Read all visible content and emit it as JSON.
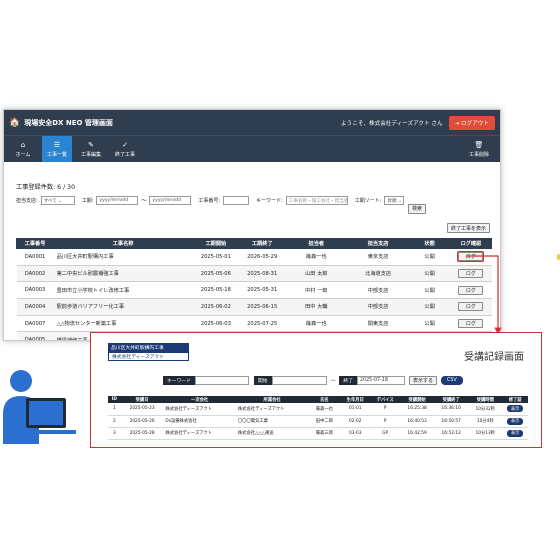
{
  "app": {
    "logo": "🏠",
    "title": "現場安全DX NEO 管理画面",
    "welcome": "ようこそ、株式会社ディーズアクト さん",
    "logout_label": "ログアウト",
    "logout_icon": "⇥"
  },
  "nav": [
    {
      "icon": "⌂",
      "label": "ホーム"
    },
    {
      "icon": "☰",
      "label": "工事一覧"
    },
    {
      "icon": "✎",
      "label": "工事編集"
    },
    {
      "icon": "✓",
      "label": "終了工事"
    },
    {
      "icon": "🗑",
      "label": "工事削除"
    }
  ],
  "projects": {
    "count_text": "工事登録件数: 6 / 30",
    "filters": {
      "branch_label": "担当支店:",
      "branch_value": "すべて ⌄",
      "period_label": "工期:",
      "date_from": "yyyy/mm/dd",
      "tilde": "〜",
      "date_to": "yyyy/mm/dd",
      "number_label": "工事番号:",
      "number_value": "",
      "keyword_label": "キーワード:",
      "keyword_placeholder": "工事名称・施工会社・担当者",
      "sort_label": "工期ソート:",
      "sort_value": "昇順 ⌄",
      "search_label": "検索"
    },
    "show_finished_label": "終了工事を表示",
    "columns": [
      "工事番号",
      "工事名称",
      "工期開始",
      "工期終了",
      "担当者",
      "担当支店",
      "状態",
      "ログ確認"
    ],
    "rows": [
      {
        "id": "DA0001",
        "name": "品川区大井町駅構内工事",
        "start": "2025-05-01",
        "end": "2026-05-29",
        "person": "篠森一也",
        "branch": "東京支店",
        "status": "公開",
        "log": "ログ"
      },
      {
        "id": "DA0002",
        "name": "第二中央ビル耐震補強工事",
        "start": "2025-05-06",
        "end": "2025-08-31",
        "person": "山田 太郎",
        "branch": "北海道支店",
        "status": "公開",
        "log": "ログ"
      },
      {
        "id": "DA0003",
        "name": "豊田市立小学校トイレ改修工事",
        "start": "2025-05-18",
        "end": "2025-05-31",
        "person": "中村 一郎",
        "branch": "中部支店",
        "status": "公開",
        "log": "ログ"
      },
      {
        "id": "DA0004",
        "name": "駅前歩道バリアフリー化工事",
        "start": "2025-06-02",
        "end": "2025-06-15",
        "person": "田中 大輔",
        "branch": "中部支店",
        "status": "公開",
        "log": "ログ"
      },
      {
        "id": "DA0007",
        "name": "△△物流センター新築工事",
        "start": "2025-06-03",
        "end": "2025-07-25",
        "person": "篠森一也",
        "branch": "関東支店",
        "status": "公開",
        "log": "ログ"
      },
      {
        "id": "DA0005",
        "name": "橋梁補修工事",
        "start": "",
        "end": "",
        "person": "",
        "branch": "",
        "status": "",
        "log": ""
      }
    ]
  },
  "panel": {
    "site_name": "品川区大井町駅構内工事",
    "company": "株式会社ディーズアクト",
    "title": "受講記録画面",
    "keyword_label": "キーワード",
    "keyword_value": "",
    "start_label": "開始",
    "start_value": "",
    "tilde": "〜",
    "end_label": "終了",
    "end_value": "2025-07-18",
    "show_label": "表示する",
    "csv_label": "CSV",
    "columns": [
      "ID",
      "受講日",
      "一次会社",
      "所属会社",
      "氏名",
      "生年月日",
      "デバイス",
      "受講開始",
      "受講終了",
      "受講時間",
      "修了証"
    ],
    "rows": [
      {
        "id": "1",
        "date": "2025-05-23",
        "primary": "株式会社ディーズアクト",
        "company": "株式会社ディーズアクト",
        "name": "篠森一也",
        "birth": "01-01",
        "device": "P",
        "start": "16:25:38",
        "end": "16:36:10",
        "duration": "10分32秒",
        "cert": "表示"
      },
      {
        "id": "2",
        "date": "2025-05-26",
        "primary": "Ds設備株式会社",
        "company": "〇〇〇電気工業",
        "name": "田中二郎",
        "birth": "02-02",
        "device": "P",
        "start": "16:40:53",
        "end": "16:50:57",
        "duration": "10分4秒",
        "cert": "表示"
      },
      {
        "id": "3",
        "date": "2025-05-28",
        "primary": "株式会社ディーズアクト",
        "company": "株式会社△△△運送",
        "name": "篠森三郎",
        "birth": "03-03",
        "device": "GP",
        "start": "16:42:59",
        "end": "16:53:12",
        "duration": "10分13秒",
        "cert": "表示"
      }
    ]
  },
  "colors": {
    "header_dark": "#2f3e4f",
    "nav_active": "#2b84d1",
    "logout": "#e04b3a",
    "highlight_red": "#d32f2f",
    "panel_navy": "#1e3a75",
    "person_blue": "#2b6fd1"
  }
}
